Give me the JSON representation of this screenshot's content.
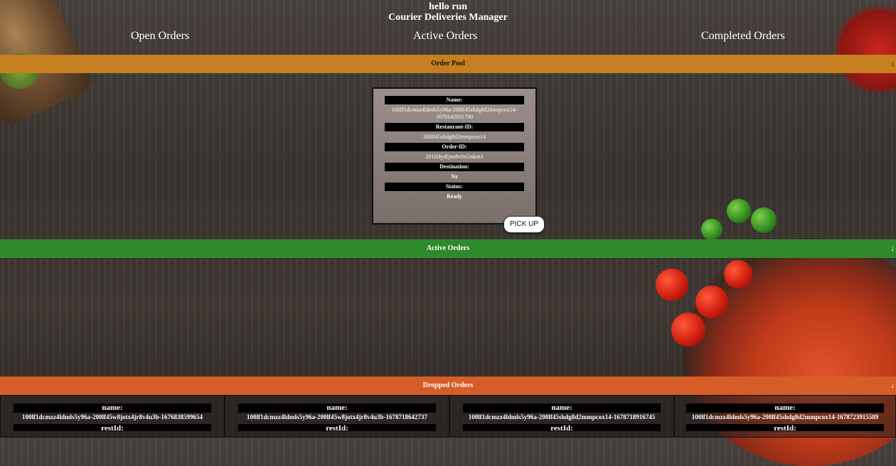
{
  "header": {
    "greeting": "hello run",
    "title": "Courier Deliveries Manager"
  },
  "nav": {
    "open": "Open Orders",
    "active": "Active Orders",
    "completed": "Completed Orders"
  },
  "sections": {
    "pool": "Order Pool",
    "active": "Active Orders",
    "dropped": "Dropped Orders",
    "arrow": "↓"
  },
  "pool_order": {
    "name_label": "Name:",
    "name": "100lf1dcmzz4ldmls5y96a-200lf45shdg8d2mmpcox14-1679142931790",
    "restaurant_label": "Restaurant-ID:",
    "restaurant_id": "200lf45shdg8d2mmpcox14",
    "order_label": "Order-ID:",
    "order_id": "201lfdydfjno8vfm5nkm3",
    "destination_label": "Destination:",
    "destination": "Nz",
    "status_label": "Status:",
    "status": "Ready",
    "pickup_label": "PICK UP"
  },
  "dropped_orders": [
    {
      "name_label": "name:",
      "name": "100lf1dcmzz4ldmls5y96a-200lf45w8jotx4jr8v4u3b-1676838599654",
      "rest_label": "restId:"
    },
    {
      "name_label": "name:",
      "name": "100lf1dcmzz4ldmls5y96a-200lf45w8jotx4jr8v4u3b-1678718642737",
      "rest_label": "restId:"
    },
    {
      "name_label": "name:",
      "name": "100lf1dcmzz4ldmls5y96a-200lf45shdg8d2mmpcox14-1678718916745",
      "rest_label": "restId:"
    },
    {
      "name_label": "name:",
      "name": "100lf1dcmzz4ldmls5y96a-200lf45shdg8d2mmpcox14-1678723915589",
      "rest_label": "restId:"
    }
  ]
}
